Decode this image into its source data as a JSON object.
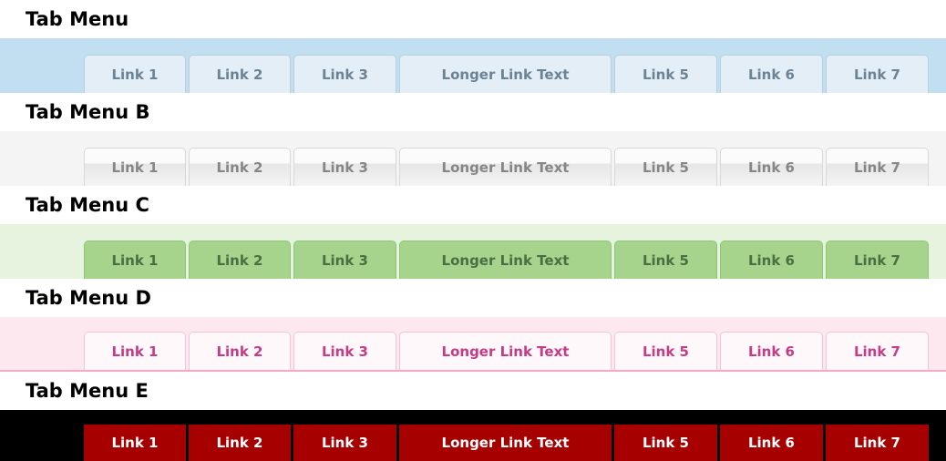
{
  "menus": [
    {
      "title": "Tab Menu",
      "links": [
        "Link 1",
        "Link 2",
        "Link 3",
        "Longer Link Text",
        "Link 5",
        "Link 6",
        "Link 7"
      ]
    },
    {
      "title": "Tab Menu B",
      "links": [
        "Link 1",
        "Link 2",
        "Link 3",
        "Longer Link Text",
        "Link 5",
        "Link 6",
        "Link 7"
      ]
    },
    {
      "title": "Tab Menu C",
      "links": [
        "Link 1",
        "Link 2",
        "Link 3",
        "Longer Link Text",
        "Link 5",
        "Link 6",
        "Link 7"
      ]
    },
    {
      "title": "Tab Menu D",
      "links": [
        "Link 1",
        "Link 2",
        "Link 3",
        "Longer Link Text",
        "Link 5",
        "Link 6",
        "Link 7"
      ]
    },
    {
      "title": "Tab Menu E",
      "links": [
        "Link 1",
        "Link 2",
        "Link 3",
        "Longer Link Text",
        "Link 5",
        "Link 6",
        "Link 7"
      ]
    }
  ],
  "colors": {
    "menu_a_bar": "#c1dff0",
    "menu_b_bar": "#f4f4f4",
    "menu_c_bar": "#e6f3df",
    "menu_d_bar": "#fde8f0",
    "menu_e_bar": "#000000",
    "menu_e_tab": "#a70000"
  }
}
